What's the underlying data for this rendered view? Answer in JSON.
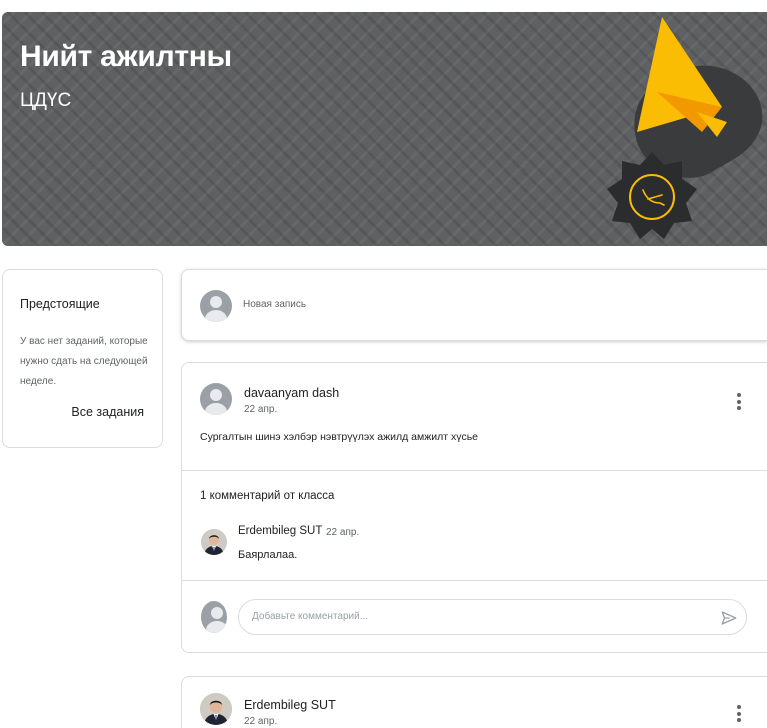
{
  "banner": {
    "title": "Нийт ажилтны",
    "subtitle": "ЦДҮС"
  },
  "upcoming": {
    "title": "Предстоящие",
    "empty_text": "У вас нет заданий, которые нужно сдать на следующей неделе.",
    "all_link": "Все задания"
  },
  "new_post": {
    "placeholder": "Новая запись"
  },
  "posts": [
    {
      "author": "davaanyam dash",
      "date": "22 апр.",
      "body": "Сургалтын шинэ хэлбэр нэвтрүүлэх ажилд амжилт хүсье",
      "comments_count": "1 комментарий от класса",
      "comment": {
        "author": "Erdembileg SUT",
        "date": "22 апр.",
        "text": "Баярлалаа."
      },
      "comment_placeholder": "Добавьте комментарий..."
    },
    {
      "author": "Erdembileg SUT",
      "date": "22 апр."
    }
  ],
  "colors": {
    "banner_bg": "#5f6062",
    "accent_yellow": "#fbbc04",
    "divider": "#dadce0"
  },
  "icons": {
    "more": "more-vert-icon",
    "send": "send-icon",
    "avatar": "account-circle-icon"
  }
}
